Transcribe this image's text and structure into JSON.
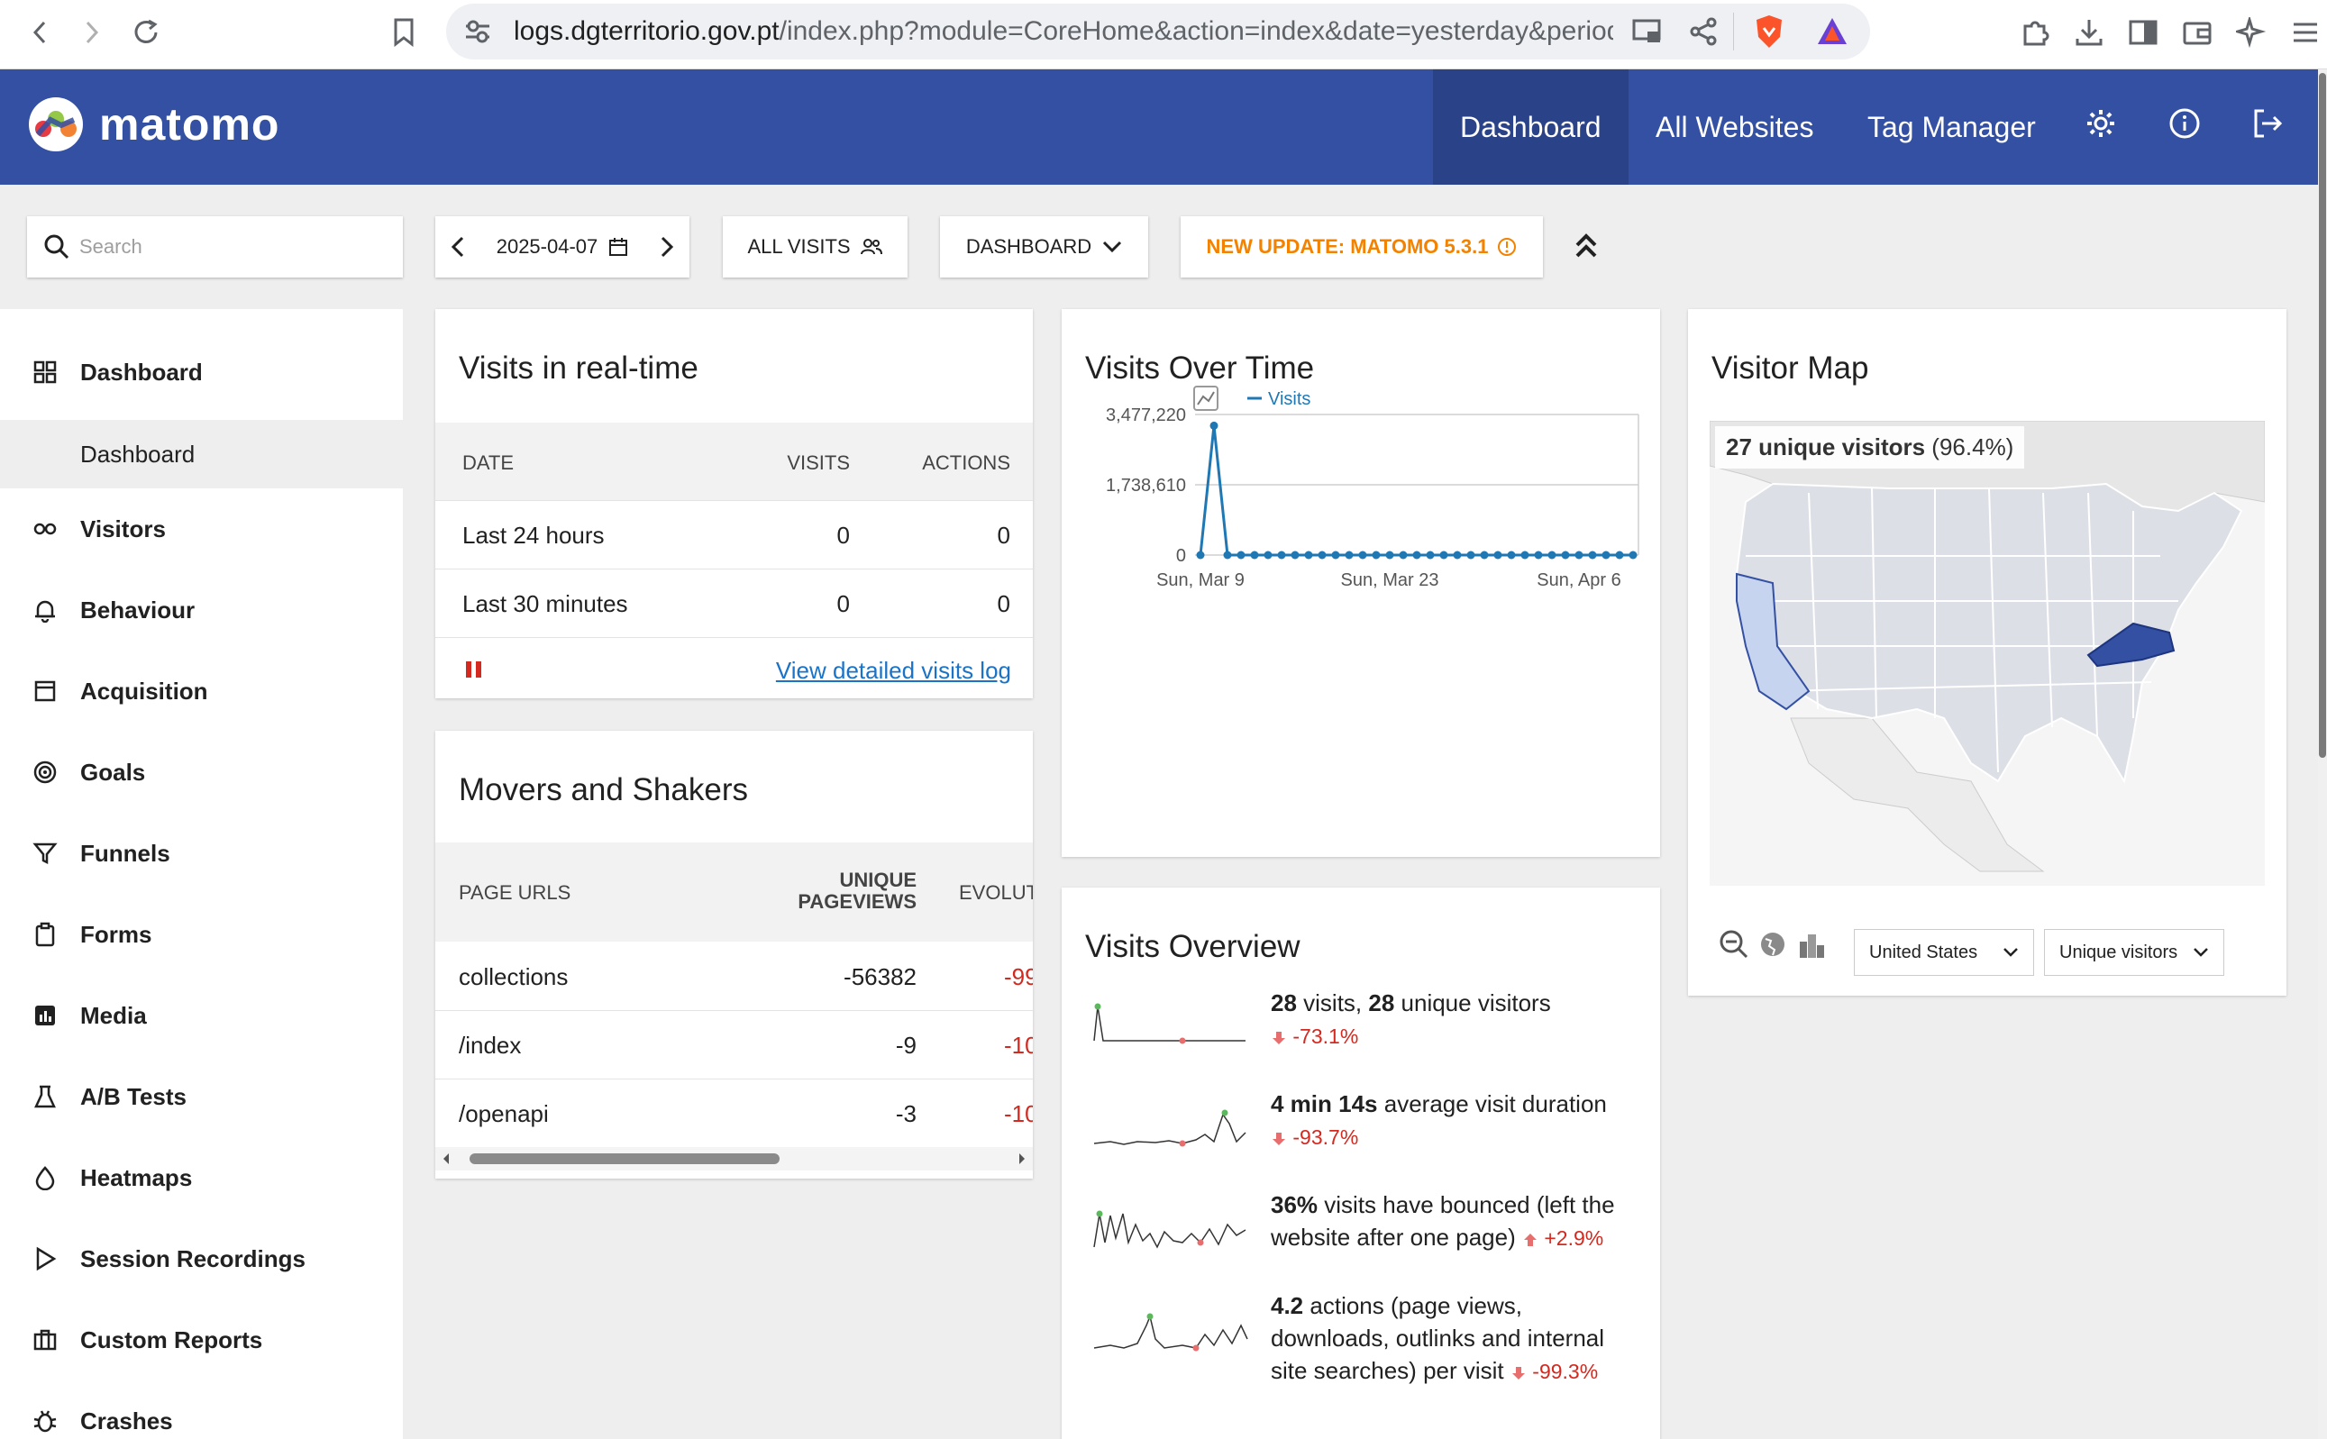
{
  "browser": {
    "url_host": "logs.dgterritorio.gov.pt",
    "url_rest": "/index.php?module=CoreHome&action=index&date=yesterday&period..."
  },
  "header": {
    "logo_text": "matomo",
    "nav": [
      "Dashboard",
      "All Websites",
      "Tag Manager"
    ]
  },
  "toolbar": {
    "search_placeholder": "Search",
    "date": "2025-04-07",
    "segment": "ALL VISITS",
    "dashboard": "DASHBOARD",
    "update": "NEW UPDATE: MATOMO 5.3.1"
  },
  "sidebar": {
    "items": [
      {
        "label": "Dashboard",
        "icon": "dashboard-icon"
      },
      {
        "label": "Visitors",
        "icon": "visitors-icon"
      },
      {
        "label": "Behaviour",
        "icon": "bell-icon"
      },
      {
        "label": "Acquisition",
        "icon": "acquisition-icon"
      },
      {
        "label": "Goals",
        "icon": "goals-icon"
      },
      {
        "label": "Funnels",
        "icon": "funnel-icon"
      },
      {
        "label": "Forms",
        "icon": "clipboard-icon"
      },
      {
        "label": "Media",
        "icon": "media-icon"
      },
      {
        "label": "A/B Tests",
        "icon": "flask-icon"
      },
      {
        "label": "Heatmaps",
        "icon": "heatmap-icon"
      },
      {
        "label": "Session Recordings",
        "icon": "play-icon"
      },
      {
        "label": "Custom Reports",
        "icon": "briefcase-icon"
      },
      {
        "label": "Crashes",
        "icon": "bug-icon"
      }
    ],
    "sub_item": "Dashboard"
  },
  "realtime": {
    "title": "Visits in real-time",
    "headers": [
      "DATE",
      "VISITS",
      "ACTIONS"
    ],
    "rows": [
      {
        "date": "Last 24 hours",
        "visits": "0",
        "actions": "0"
      },
      {
        "date": "Last 30 minutes",
        "visits": "0",
        "actions": "0"
      }
    ],
    "link": "View detailed visits log"
  },
  "movers": {
    "title": "Movers and Shakers",
    "headers": [
      "PAGE URLS",
      "UNIQUE",
      "PAGEVIEWS",
      "EVOLUT"
    ],
    "rows": [
      {
        "url": "collections",
        "value": "-56382",
        "evolution": "-99"
      },
      {
        "url": "/index",
        "value": "-9",
        "evolution": "-10"
      },
      {
        "url": "/openapi",
        "value": "-3",
        "evolution": "-10"
      }
    ]
  },
  "visits_over_time": {
    "title": "Visits Over Time",
    "legend": "Visits",
    "y_ticks": [
      "3,477,220",
      "1,738,610",
      "0"
    ],
    "x_ticks": [
      "Sun, Mar 9",
      "Sun, Mar 23",
      "Sun, Apr 6"
    ]
  },
  "chart_data": {
    "type": "line",
    "title": "Visits Over Time",
    "series": [
      {
        "name": "Visits",
        "values": [
          0,
          3200000,
          0,
          0,
          0,
          0,
          0,
          0,
          0,
          0,
          0,
          0,
          0,
          0,
          0,
          0,
          0,
          0,
          0,
          0,
          0,
          0,
          0,
          0,
          0,
          0,
          0,
          0,
          0,
          0,
          0,
          0,
          0
        ]
      }
    ],
    "x_labels": [
      "Sun, Mar 9",
      "Sun, Mar 23",
      "Sun, Apr 6"
    ],
    "ylim": [
      0,
      3477220
    ],
    "grid": true,
    "legend": "top-left"
  },
  "overview": {
    "title": "Visits Overview",
    "rows": [
      {
        "bold1": "28",
        "t1": " visits, ",
        "bold2": "28",
        "t2": " unique visitors",
        "change": "-73.1%",
        "dir": "down"
      },
      {
        "bold1": "4 min 14s",
        "t1": " average visit duration",
        "bold2": "",
        "t2": "",
        "change": "-93.7%",
        "dir": "down"
      },
      {
        "bold1": "36%",
        "t1": " visits have bounced (left the website after one page)",
        "bold2": "",
        "t2": "",
        "change": "+2.9%",
        "dir": "up"
      },
      {
        "bold1": "4.2",
        "t1": " actions (page views, downloads, outlinks and internal site searches) per visit",
        "bold2": "",
        "t2": "",
        "change": "-99.3%",
        "dir": "down"
      }
    ]
  },
  "visitor_map": {
    "title": "Visitor Map",
    "info_bold": "27 unique visitors",
    "info_rest": " (96.4%)",
    "region_select": "United States",
    "metric_select": "Unique visitors"
  },
  "colors": {
    "header_bg": "#3450a3",
    "accent_orange": "#f38200",
    "negative": "#d4291f",
    "chart_line": "#1f78b4"
  }
}
